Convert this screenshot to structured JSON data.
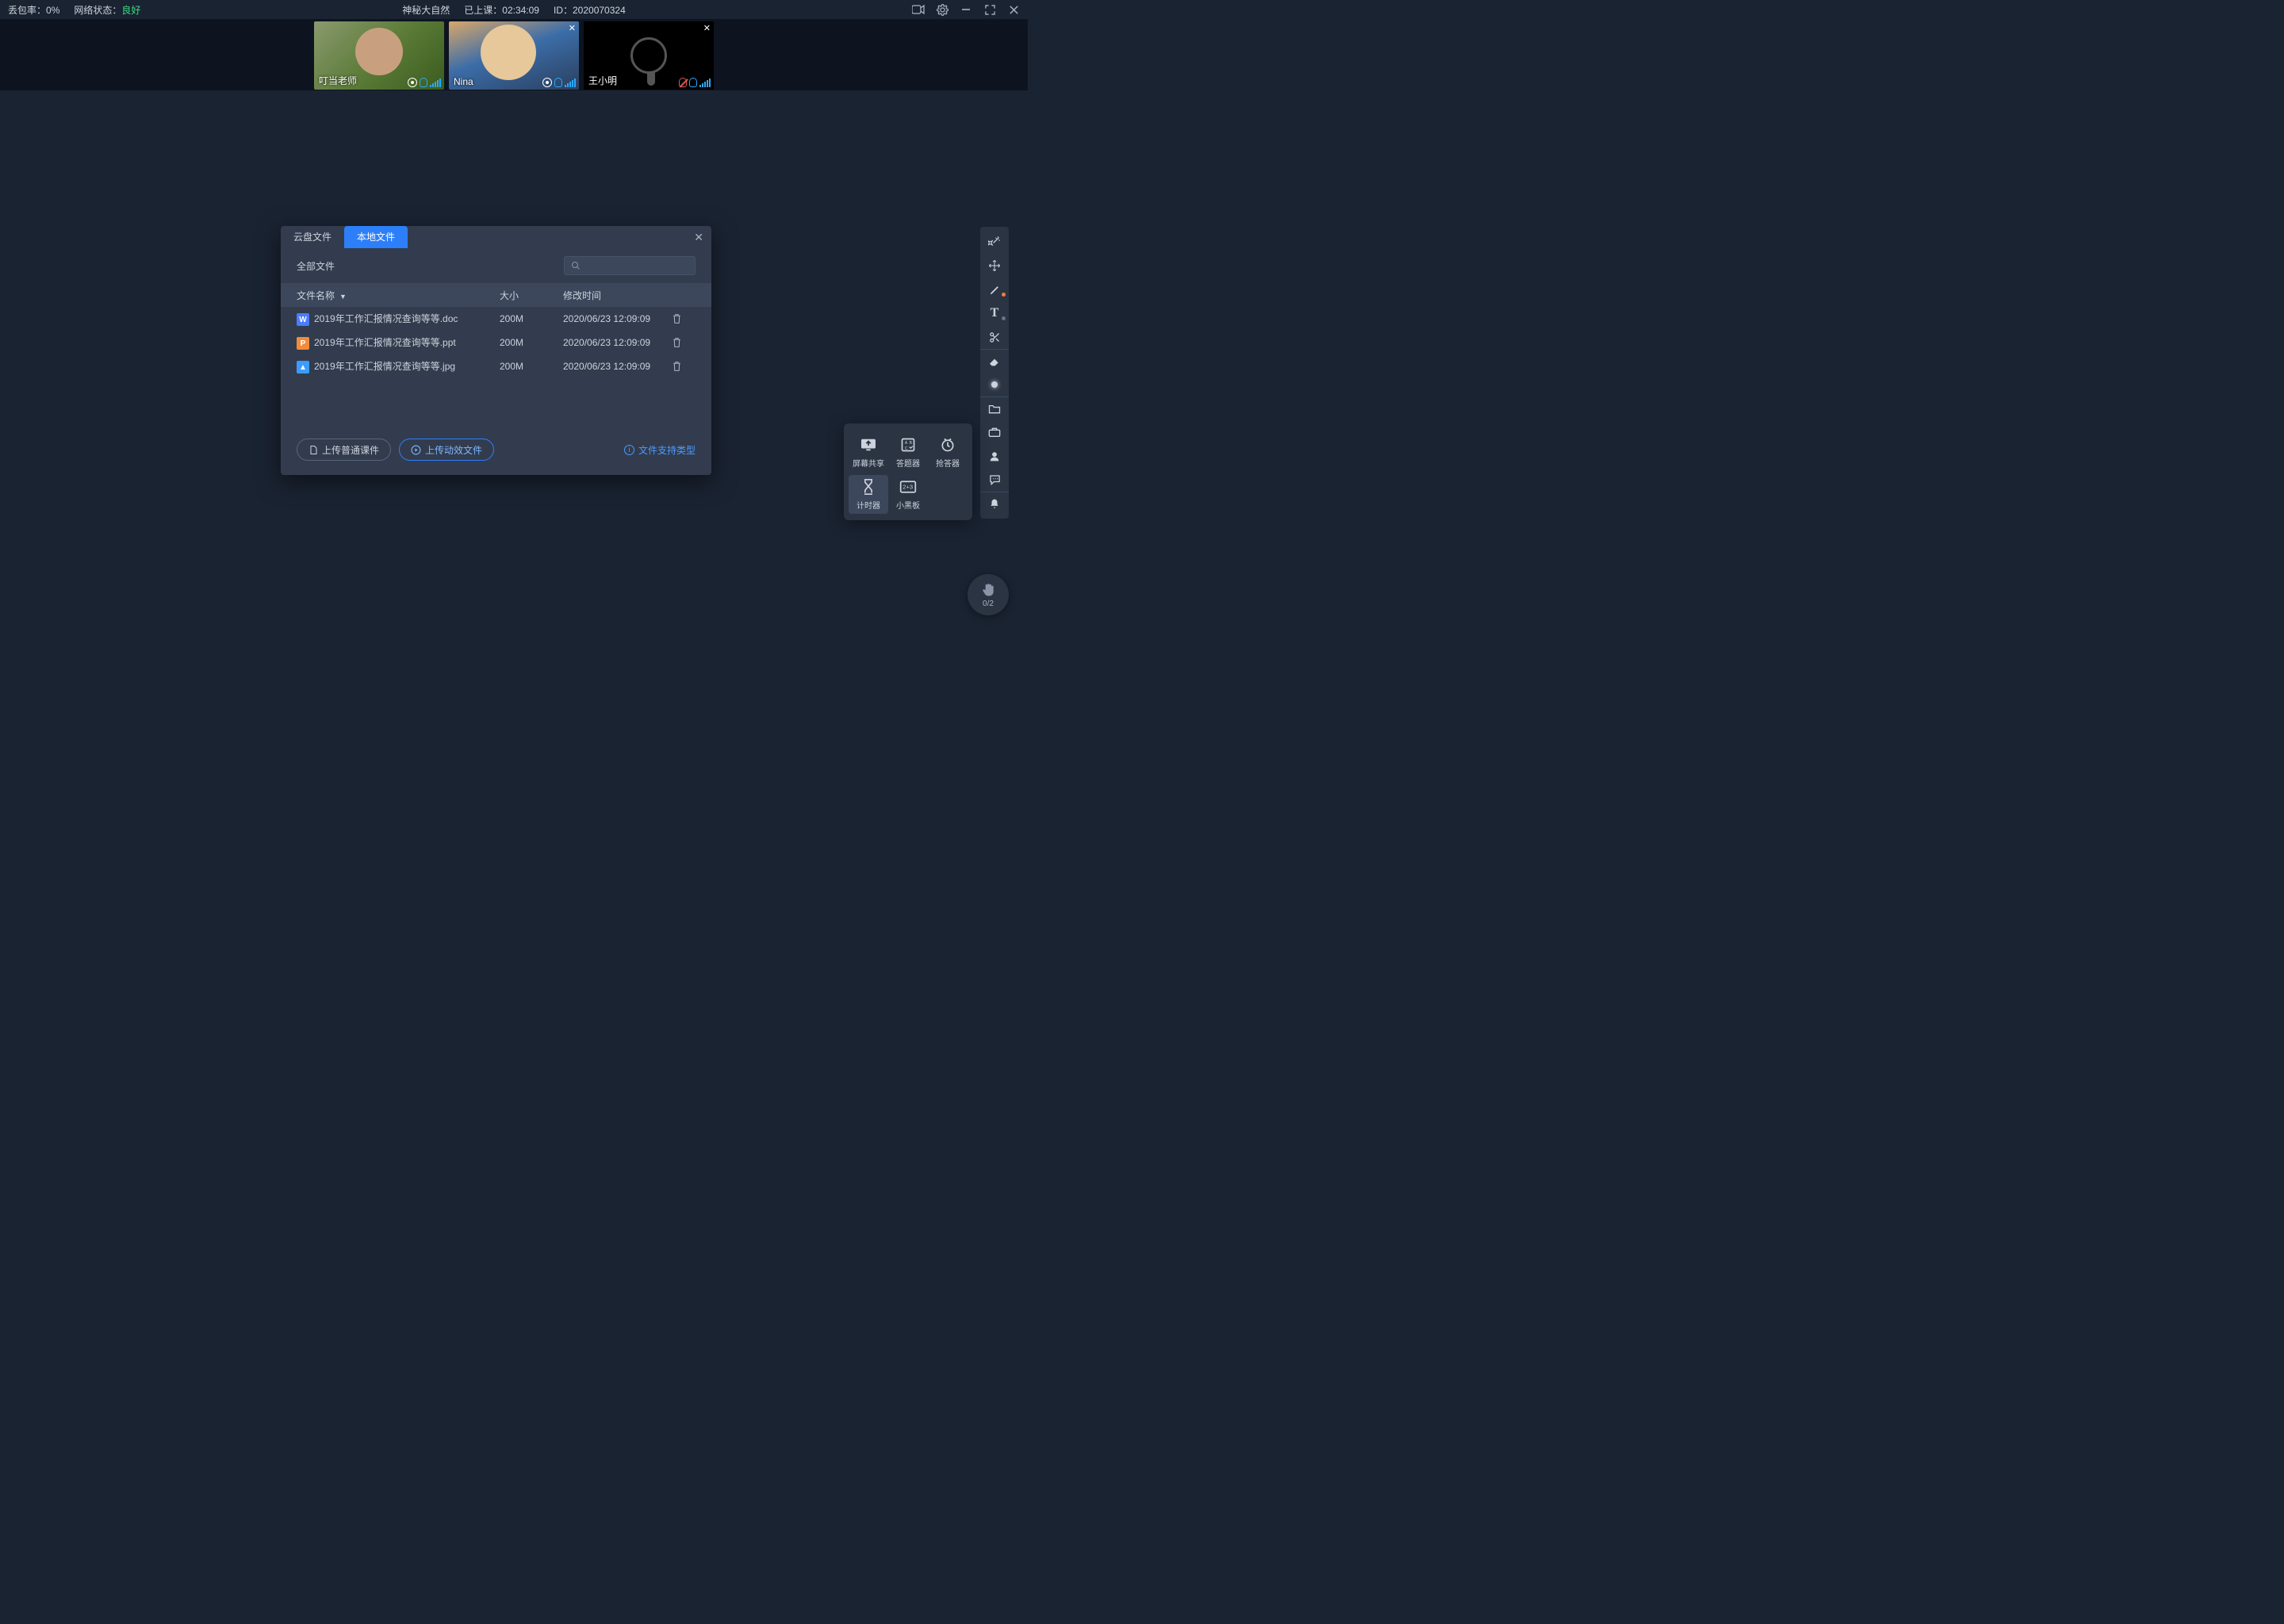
{
  "topbar": {
    "packetloss_label": "丢包率：",
    "packetloss_value": "0%",
    "network_label": "网络状态：",
    "network_value": "良好",
    "title": "神秘大自然",
    "elapsed_label": "已上课：",
    "elapsed_value": "02:34:09",
    "id_label": "ID：",
    "id_value": "2020070324"
  },
  "videos": [
    {
      "name": "叮当老师",
      "camera": "on",
      "mic": "on",
      "closable": false
    },
    {
      "name": "Nina",
      "camera": "on",
      "mic": "on",
      "closable": true
    },
    {
      "name": "王小明",
      "camera": "off",
      "mic": "off",
      "closable": true
    }
  ],
  "modal": {
    "tab_cloud": "云盘文件",
    "tab_local": "本地文件",
    "all_files": "全部文件",
    "search_placeholder": "",
    "col_name": "文件名称",
    "col_size": "大小",
    "col_time": "修改时间",
    "files": [
      {
        "icon": "W",
        "cls": "doc",
        "name": "2019年工作汇报情况查询等等.doc",
        "size": "200M",
        "time": "2020/06/23 12:09:09"
      },
      {
        "icon": "P",
        "cls": "ppt",
        "name": "2019年工作汇报情况查询等等.ppt",
        "size": "200M",
        "time": "2020/06/23 12:09:09"
      },
      {
        "icon": "▲",
        "cls": "jpg",
        "name": "2019年工作汇报情况查询等等.jpg",
        "size": "200M",
        "time": "2020/06/23 12:09:09"
      }
    ],
    "btn_upload_normal": "上传普通课件",
    "btn_upload_dynamic": "上传动效文件",
    "link_supported": "文件支持类型"
  },
  "toolpop": {
    "screen": "屏幕共享",
    "answer": "答题器",
    "buzzer": "抢答器",
    "timer": "计时器",
    "board": "小黑板"
  },
  "hand": {
    "count": "0/2"
  }
}
